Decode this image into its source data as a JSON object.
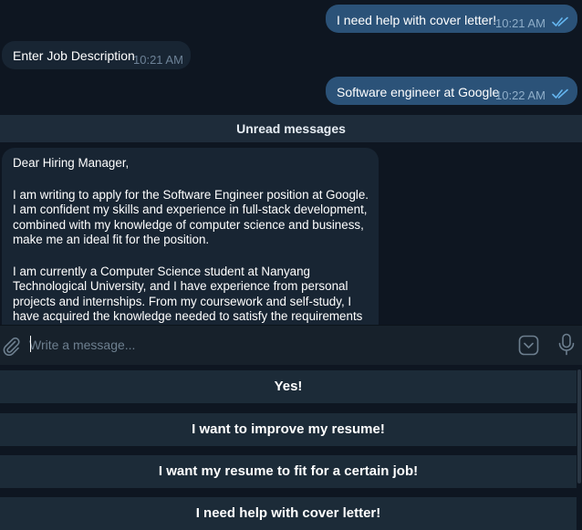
{
  "messages": [
    {
      "direction": "out",
      "text": "I need help with cover letter!",
      "time": "10:21 AM",
      "status": "read"
    },
    {
      "direction": "in",
      "text": "Enter Job Description",
      "time": "10:21 AM"
    },
    {
      "direction": "out",
      "text": "Software engineer at Google",
      "time": "10:22 AM",
      "status": "read"
    }
  ],
  "unread_label": "Unread messages",
  "letter": {
    "paragraphs": [
      "Dear Hiring Manager,",
      "I am writing to apply for the Software Engineer position at Google. I am confident my skills and experience in full-stack development, combined with my knowledge of computer science and business, make me an ideal fit for the position.",
      "I am currently a Computer Science student at Nanyang Technological University, and I have experience from personal projects and internships. From my coursework and self-study, I have acquired the knowledge needed to satisfy the requirements of this"
    ]
  },
  "composer": {
    "placeholder": "Write a message...",
    "attach_icon": "paperclip-icon",
    "keyboard_icon": "keyboard-toggle-icon",
    "mic_icon": "microphone-icon"
  },
  "keyboard": {
    "buttons": [
      "Yes!",
      "I want to improve my resume!",
      "I want my resume to fit for a certain job!",
      "I need help with cover letter!"
    ]
  },
  "colors": {
    "background": "#0e1621",
    "outgoing_bubble": "#2b5278",
    "incoming_bubble": "#182533",
    "keyboard_button": "#1c2b38",
    "read_check": "#64b5ef"
  }
}
